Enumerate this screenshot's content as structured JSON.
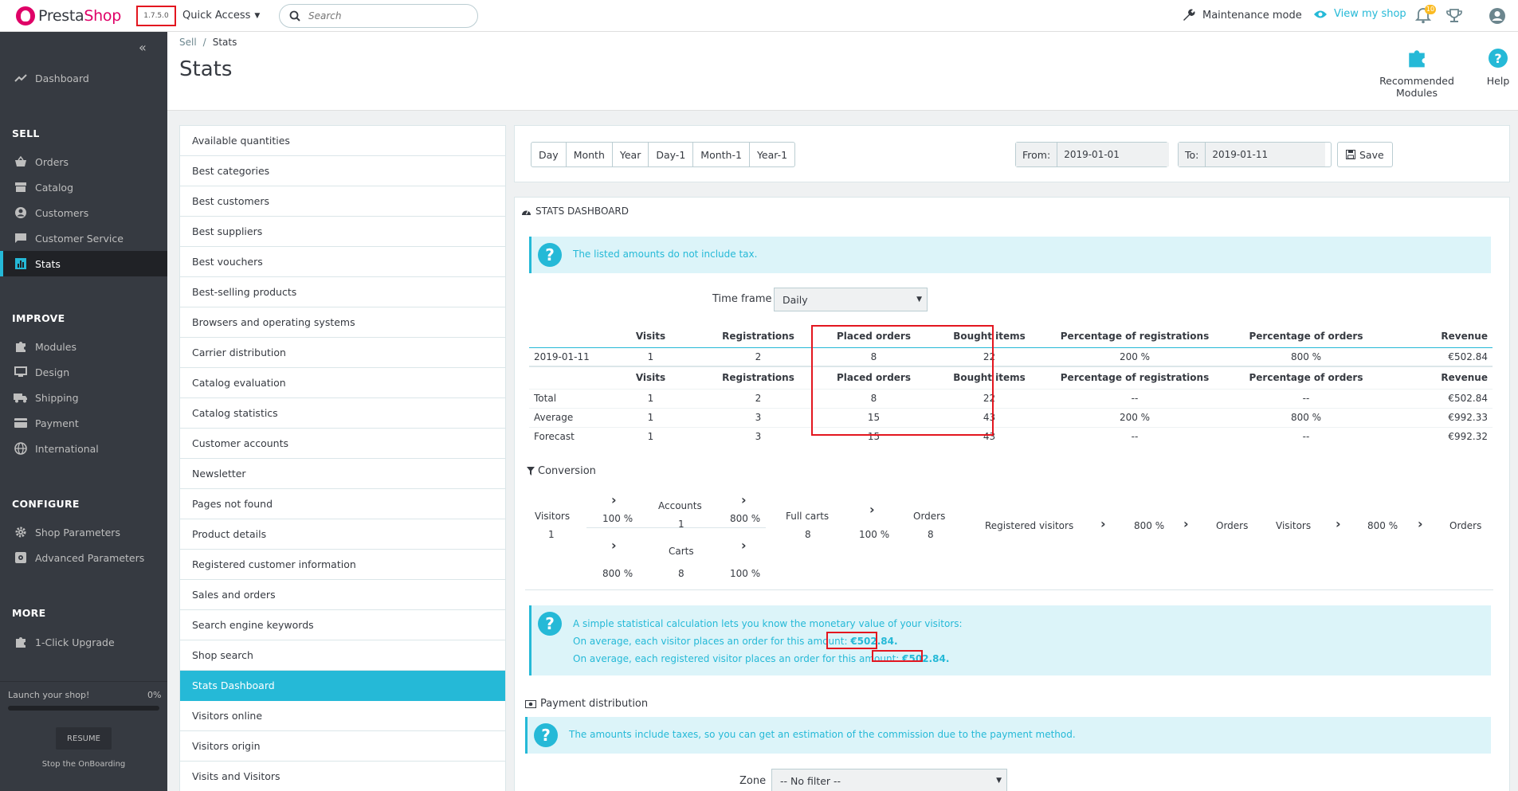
{
  "header": {
    "logo_a": "Presta",
    "logo_b": "Shop",
    "version": "1.7.5.0",
    "quick_access": "Quick Access",
    "search_placeholder": "Search",
    "maintenance": "Maintenance mode",
    "view_shop": "View my shop",
    "notif_count": "10"
  },
  "sidebar": {
    "dashboard": "Dashboard",
    "sell_title": "SELL",
    "orders": "Orders",
    "catalog": "Catalog",
    "customers": "Customers",
    "customer_service": "Customer Service",
    "stats": "Stats",
    "improve_title": "IMPROVE",
    "modules": "Modules",
    "design": "Design",
    "shipping": "Shipping",
    "payment": "Payment",
    "international": "International",
    "configure_title": "CONFIGURE",
    "shop_parameters": "Shop Parameters",
    "advanced_parameters": "Advanced Parameters",
    "more_title": "MORE",
    "upgrade": "1-Click Upgrade",
    "launch": "Launch your shop!",
    "launch_pct": "0%",
    "launch_progress": 0,
    "resume": "RESUME",
    "stop": "Stop the OnBoarding"
  },
  "pagehead": {
    "crumb_sell": "Sell",
    "crumb_sep": "/",
    "crumb_stats": "Stats",
    "title": "Stats",
    "recommended": "Recommended Modules",
    "help": "Help"
  },
  "modules": [
    "Available quantities",
    "Best categories",
    "Best customers",
    "Best suppliers",
    "Best vouchers",
    "Best-selling products",
    "Browsers and operating systems",
    "Carrier distribution",
    "Catalog evaluation",
    "Catalog statistics",
    "Customer accounts",
    "Newsletter",
    "Pages not found",
    "Product details",
    "Registered customer information",
    "Sales and orders",
    "Search engine keywords",
    "Shop search",
    "Stats Dashboard",
    "Visitors online",
    "Visitors origin",
    "Visits and Visitors"
  ],
  "active_module": "Stats Dashboard",
  "dates": {
    "periods": [
      "Day",
      "Month",
      "Year",
      "Day-1",
      "Month-1",
      "Year-1"
    ],
    "from_label": "From:",
    "from_value": "2019-01-01",
    "to_label": "To:",
    "to_value": "2019-01-11",
    "save": "Save"
  },
  "stats": {
    "heading": "STATS DASHBOARD",
    "tax_note": "The listed amounts do not include tax.",
    "timeframe_label": "Time frame",
    "timeframe_value": "Daily",
    "columns": [
      "",
      "Visits",
      "Registrations",
      "Placed orders",
      "Bought items",
      "Percentage of registrations",
      "Percentage of orders",
      "Revenue"
    ],
    "rows": [
      [
        "2019-01-11",
        "1",
        "2",
        "8",
        "22",
        "200 %",
        "800 %",
        "€502.84"
      ]
    ],
    "summary": [
      [
        "Total",
        "1",
        "2",
        "8",
        "22",
        "--",
        "--",
        "€502.84"
      ],
      [
        "Average",
        "1",
        "3",
        "15",
        "43",
        "200 %",
        "800 %",
        "€992.33"
      ],
      [
        "Forecast",
        "1",
        "3",
        "15",
        "43",
        "--",
        "--",
        "€992.32"
      ]
    ]
  },
  "conversion": {
    "title": "Conversion",
    "visitors": "Visitors",
    "visitors_val": "1",
    "p1": "100 %",
    "accounts": "Accounts",
    "accounts_val": "1",
    "p2": "800 %",
    "p3": "800 %",
    "carts": "Carts",
    "carts_val": "8",
    "p4": "100 %",
    "full_carts": "Full carts",
    "full_carts_val": "8",
    "p5": "100 %",
    "orders": "Orders",
    "orders_val": "8",
    "registered_visitors": "Registered visitors",
    "p6": "800 %",
    "orders2": "Orders",
    "visitors2": "Visitors",
    "p7": "800 %",
    "orders3": "Orders"
  },
  "value_note": {
    "line1": "A simple statistical calculation lets you know the monetary value of your visitors:",
    "line2": "On average, each visitor places an order for this amount:",
    "amount1": "€502.84.",
    "line3": "On average, each registered visitor places an order for this amount:",
    "amount2": "€502.84."
  },
  "payment": {
    "title": "Payment distribution",
    "note": "The amounts include taxes, so you can get an estimation of the commission due to the payment method.",
    "zone_label": "Zone",
    "zone_value": "-- No filter --"
  }
}
